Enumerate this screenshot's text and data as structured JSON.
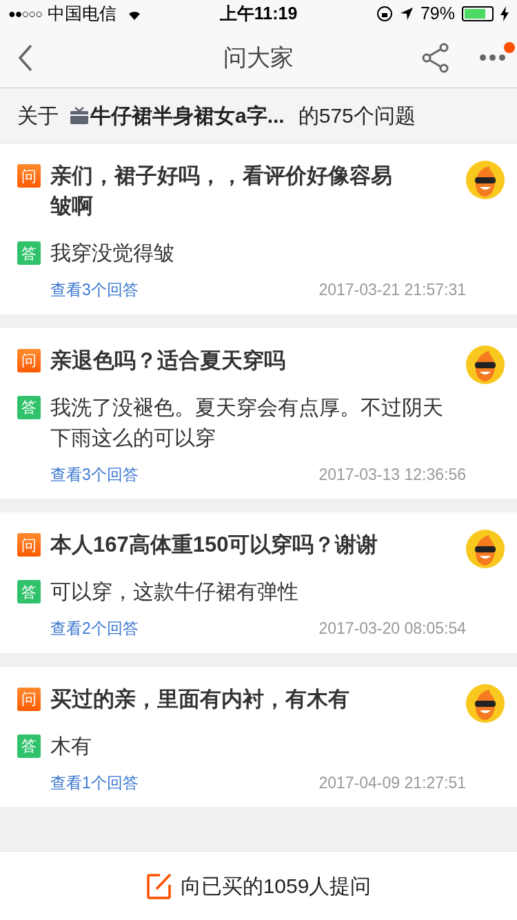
{
  "status_bar": {
    "signal": "●●○○○",
    "carrier": "中国电信",
    "time": "上午11:19",
    "battery": "79%"
  },
  "nav": {
    "title": "问大家",
    "has_notification": true
  },
  "summary": {
    "prefix": "关于",
    "product": "牛仔裙半身裙女a字...",
    "suffix": "的575个问题"
  },
  "questions": [
    {
      "q_badge": "问",
      "question": "亲们，裙子好吗，，看评价好像容易皱啊",
      "a_badge": "答",
      "answer": "我穿没觉得皱",
      "link": "查看3个回答",
      "time": "2017-03-21 21:57:31"
    },
    {
      "q_badge": "问",
      "question": "亲退色吗？适合夏天穿吗",
      "a_badge": "答",
      "answer": "我洗了没褪色。夏天穿会有点厚。不过阴天下雨这么的可以穿",
      "link": "查看3个回答",
      "time": "2017-03-13 12:36:56"
    },
    {
      "q_badge": "问",
      "question": "本人167高体重150可以穿吗？谢谢",
      "a_badge": "答",
      "answer": "可以穿，这款牛仔裙有弹性",
      "link": "查看2个回答",
      "time": "2017-03-20 08:05:54"
    },
    {
      "q_badge": "问",
      "question": "买过的亲，里面有内衬，有木有",
      "a_badge": "答",
      "answer": "木有",
      "link": "查看1个回答",
      "time": "2017-04-09 21:27:51"
    }
  ],
  "ask_button": {
    "label": "向已买的1059人提问"
  }
}
